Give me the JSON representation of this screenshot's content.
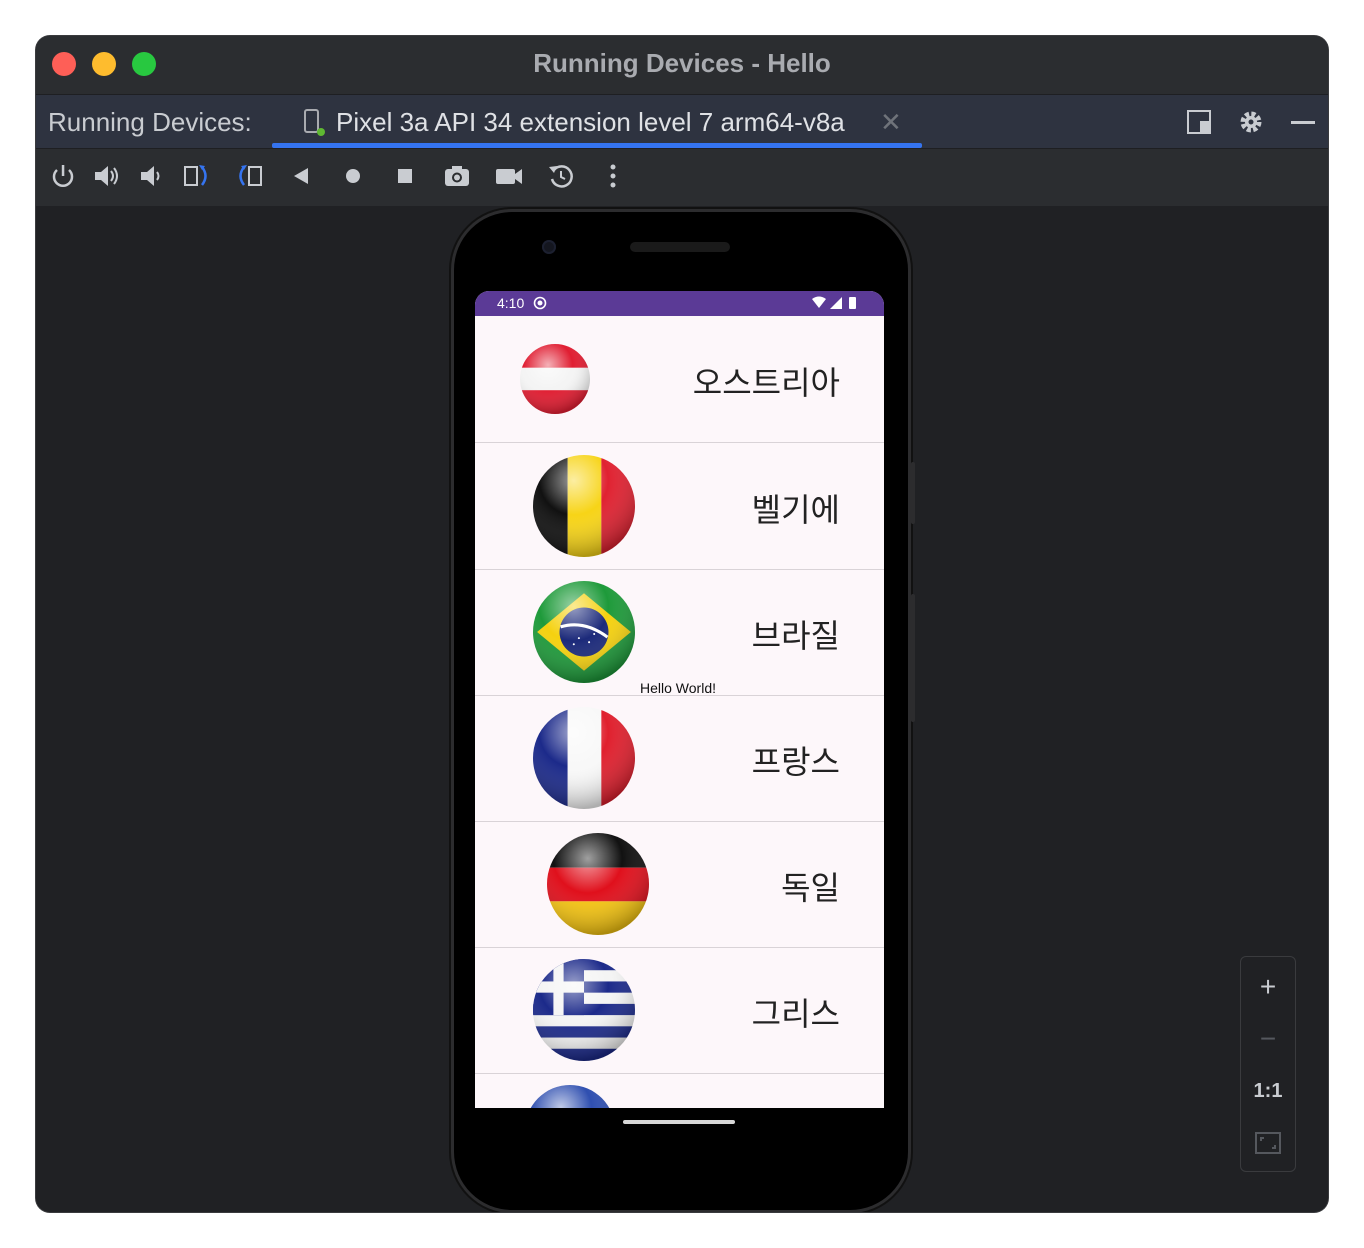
{
  "window": {
    "title": "Running Devices - Hello"
  },
  "tabbar": {
    "label": "Running Devices:",
    "tab_label": "Pixel 3a API 34 extension level 7 arm64-v8a",
    "tab_close": "✕"
  },
  "toolbar": {
    "icons": [
      "power-icon",
      "volume-up-icon",
      "volume-down-icon",
      "rotate-left-icon",
      "rotate-right-icon",
      "back-icon",
      "home-icon",
      "overview-icon",
      "screenshot-icon",
      "screen-record-icon",
      "reset-icon",
      "more-icon"
    ]
  },
  "device": {
    "status_time": "4:10",
    "hello_text": "Hello World!",
    "countries": [
      {
        "name": "오스트리아",
        "flag": "austria"
      },
      {
        "name": "벨기에",
        "flag": "belgium"
      },
      {
        "name": "브라질",
        "flag": "brazil"
      },
      {
        "name": "프랑스",
        "flag": "france"
      },
      {
        "name": "독일",
        "flag": "germany"
      },
      {
        "name": "그리스",
        "flag": "greece"
      }
    ]
  },
  "zoom": {
    "zoom_in": "+",
    "zoom_out": "−",
    "actual_size": "1:1"
  },
  "colors": {
    "accent": "#3574f0",
    "status_bar": "#5b3a96",
    "screen_bg": "#fdf7fa"
  }
}
